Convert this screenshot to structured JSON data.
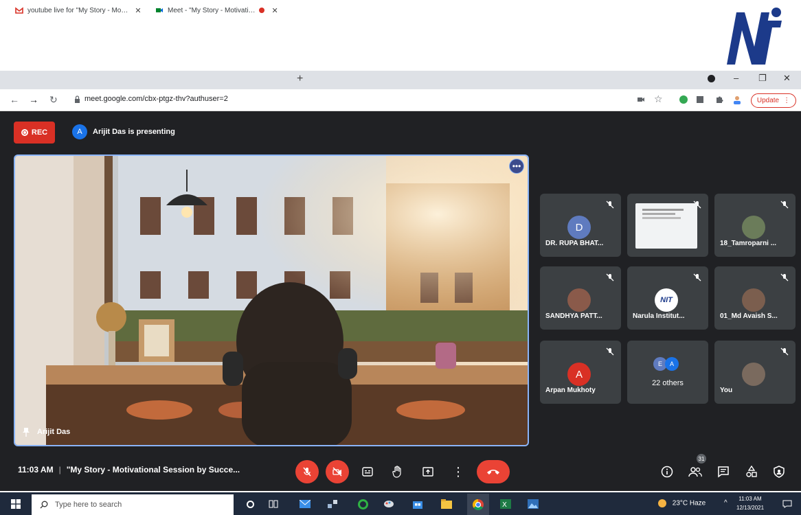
{
  "logo": {
    "text": "NIT"
  },
  "browser": {
    "tabs": [
      {
        "title": "youtube live for \"My Story - Mo…",
        "active": false
      },
      {
        "title": "Meet - \"My Story - Motivati…",
        "active": true
      }
    ],
    "url": "meet.google.com/cbx-ptgz-thv?authuser=2",
    "update_label": "Update"
  },
  "meet": {
    "rec_label": "REC",
    "presenter_initial": "A",
    "presenting_text": "Arijit Das is presenting",
    "main_video_name": "Arijit Das",
    "participants": [
      {
        "name": "DR. RUPA BHAT...",
        "initial": "D",
        "color": "#5f7bbf"
      },
      {
        "name": "",
        "initial": "",
        "color": ""
      },
      {
        "name": "18_Tamroparni ...",
        "initial": "",
        "color": ""
      },
      {
        "name": "SANDHYA PATT...",
        "initial": "",
        "color": ""
      },
      {
        "name": "Narula Institut...",
        "initial": "NIT",
        "color": "#ffffff"
      },
      {
        "name": "01_Md Avaish S...",
        "initial": "",
        "color": ""
      },
      {
        "name": "Arpan Mukhoty",
        "initial": "A",
        "color": "#d93025"
      },
      {
        "name": "22 others",
        "initial": "",
        "color": ""
      },
      {
        "name": "You",
        "initial": "",
        "color": ""
      }
    ],
    "time": "11:03 AM",
    "meeting_title": "\"My Story - Motivational Session by Succe...",
    "people_count": "31"
  },
  "taskbar": {
    "search_placeholder": "Type here to search",
    "weather": "23°C  Haze",
    "clock_time": "11:03 AM",
    "clock_date": "12/13/2021"
  }
}
